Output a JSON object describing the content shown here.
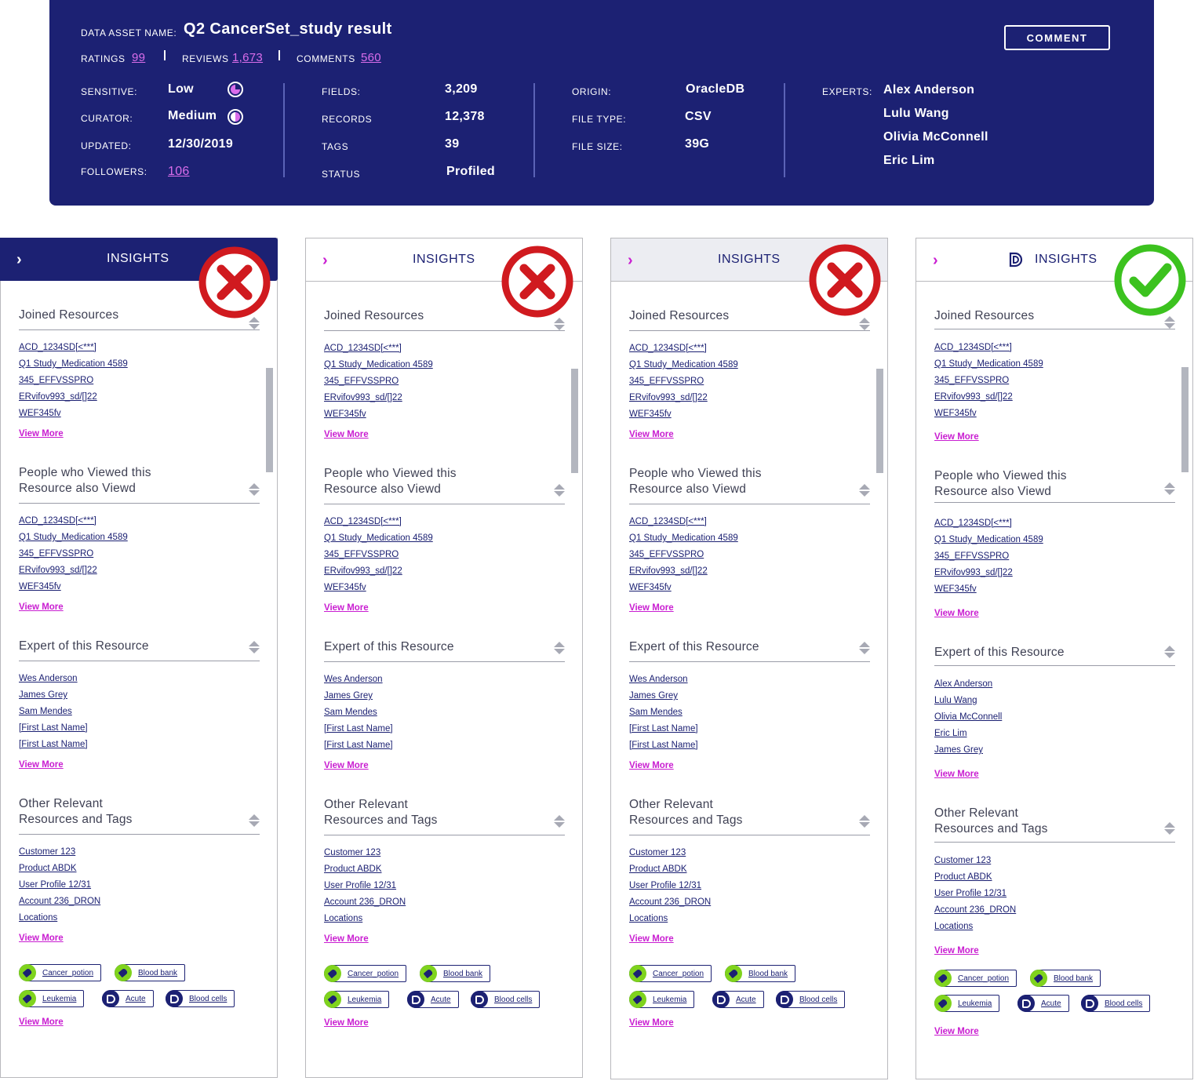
{
  "header": {
    "asset_name_label": "DATA ASSET NAME:",
    "asset_name": "Q2 CancerSet_study result",
    "ratings_label": "RATINGS",
    "ratings": "99",
    "reviews_label": "REVIEWS",
    "reviews": "1,673",
    "comments_label": "COMMENTS",
    "comments": "560",
    "comment_button": "COMMENT",
    "col1": {
      "sensitive_label": "SENSITIVE:",
      "sensitive": "Low",
      "curator_label": "CURATOR:",
      "curator": "Medium",
      "updated_label": "UPDATED:",
      "updated": "12/30/2019",
      "followers_label": "FOLLOWERS:",
      "followers": "106"
    },
    "col2": {
      "fields_label": "FIELDS:",
      "fields": "3,209",
      "records_label": "RECORDS",
      "records": "12,378",
      "tags_label": "TAGS",
      "tags": "39",
      "status_label": "STATUS",
      "status": "Profiled"
    },
    "col3": {
      "origin_label": "ORIGIN:",
      "origin": "OracleDB",
      "filetype_label": "FILE TYPE:",
      "filetype": "CSV",
      "filesize_label": "FILE SIZE:",
      "filesize": "39G"
    },
    "col4": {
      "experts_label": "EXPERTS:",
      "experts": [
        "Alex Anderson",
        "Lulu Wang",
        "Olivia McConnell",
        "Eric Lim"
      ]
    }
  },
  "colors": {
    "navy": "#1c2173",
    "magenta": "#c91ed1",
    "header_link": "#d96dea",
    "tag_green": "#7fd31d",
    "wrong_red": "#d01a1f",
    "right_green": "#3cc21f"
  },
  "panels": [
    {
      "variant": "wrong",
      "header_title": "INSIGHTS",
      "chevron": "›",
      "sections": {
        "joined_title": "Joined Resources",
        "joined_links": [
          "ACD_1234SD[<***]",
          "Q1 Study_Medication 4589",
          "345_EFFVSSPRO",
          "ERvifov993_sd/[]22",
          "WEF345fv"
        ],
        "viewed_title_1": "People who Viewed this",
        "viewed_title_2": "Resource also Viewd",
        "viewed_links": [
          "ACD_1234SD[<***]",
          "Q1 Study_Medication 4589",
          "345_EFFVSSPRO",
          "ERvifov993_sd/[]22",
          "WEF345fv"
        ],
        "expert_title": "Expert of this Resource",
        "expert_links": [
          "Wes Anderson",
          "James Grey",
          "Sam Mendes",
          "[First Last Name]",
          "[First Last Name]"
        ],
        "other_title_1": "Other Relevant",
        "other_title_2": "Resources and Tags",
        "other_links": [
          "Customer 123",
          "Product ABDK",
          "User Profile 12/31",
          "Account 236_DRON",
          "Locations"
        ],
        "tags": [
          "Cancer_potion",
          "Blood bank",
          "Leukemia",
          "Acute",
          "Blood cells"
        ],
        "view_more": "View More"
      }
    },
    {
      "variant": "wrong",
      "header_title": "INSIGHTS",
      "chevron": "›",
      "sections": {
        "joined_title": "Joined Resources",
        "joined_links": [
          "ACD_1234SD[<***]",
          "Q1 Study_Medication 4589",
          "345_EFFVSSPRO",
          "ERvifov993_sd/[]22",
          "WEF345fv"
        ],
        "viewed_title_1": "People who Viewed this",
        "viewed_title_2": "Resource also Viewd",
        "viewed_links": [
          "ACD_1234SD[<***]",
          "Q1 Study_Medication 4589",
          "345_EFFVSSPRO",
          "ERvifov993_sd/[]22",
          "WEF345fv"
        ],
        "expert_title": "Expert of this Resource",
        "expert_links": [
          "Wes Anderson",
          "James Grey",
          "Sam Mendes",
          "[First Last Name]",
          "[First Last Name]"
        ],
        "other_title_1": "Other Relevant",
        "other_title_2": "Resources and Tags",
        "other_links": [
          "Customer 123",
          "Product ABDK",
          "User Profile 12/31",
          "Account 236_DRON",
          "Locations"
        ],
        "tags": [
          "Cancer_potion",
          "Blood bank",
          "Leukemia",
          "Acute",
          "Blood cells"
        ],
        "view_more": "View More"
      }
    },
    {
      "variant": "wrong",
      "header_title": "INSIGHTS",
      "chevron": "›",
      "sections": {
        "joined_title": "Joined Resources",
        "joined_links": [
          "ACD_1234SD[<***]",
          "Q1 Study_Medication 4589",
          "345_EFFVSSPRO",
          "ERvifov993_sd/[]22",
          "WEF345fv"
        ],
        "viewed_title_1": "People who Viewed this",
        "viewed_title_2": "Resource also Viewd",
        "viewed_links": [
          "ACD_1234SD[<***]",
          "Q1 Study_Medication 4589",
          "345_EFFVSSPRO",
          "ERvifov993_sd/[]22",
          "WEF345fv"
        ],
        "expert_title": "Expert of this Resource",
        "expert_links": [
          "Wes Anderson",
          "James Grey",
          "Sam Mendes",
          "[First Last Name]",
          "[First Last Name]"
        ],
        "other_title_1": "Other Relevant",
        "other_title_2": "Resources and Tags",
        "other_links": [
          "Customer 123",
          "Product ABDK",
          "User Profile 12/31",
          "Account 236_DRON",
          "Locations"
        ],
        "tags": [
          "Cancer_potion",
          "Blood bank",
          "Leukemia",
          "Acute",
          "Blood cells"
        ],
        "view_more": "View More"
      }
    },
    {
      "variant": "right",
      "header_title": "INSIGHTS",
      "chevron": "›",
      "sections": {
        "joined_title": "Joined Resources",
        "joined_links": [
          "ACD_1234SD[<***]",
          "Q1 Study_Medication 4589",
          "345_EFFVSSPRO",
          "ERvifov993_sd/[]22",
          "WEF345fv"
        ],
        "viewed_title_1": "People who Viewed this",
        "viewed_title_2": "Resource also Viewd",
        "viewed_links": [
          "ACD_1234SD[<***]",
          "Q1 Study_Medication 4589",
          "345_EFFVSSPRO",
          "ERvifov993_sd/[]22",
          "WEF345fv"
        ],
        "expert_title": "Expert of this Resource",
        "expert_links": [
          "Alex Anderson",
          "Lulu Wang",
          "Olivia McConnell",
          "Eric Lim",
          "James Grey"
        ],
        "other_title_1": "Other Relevant",
        "other_title_2": "Resources and Tags",
        "other_links": [
          "Customer 123",
          "Product ABDK",
          "User Profile 12/31",
          "Account 236_DRON",
          "Locations"
        ],
        "tags": [
          "Cancer_potion",
          "Blood bank",
          "Leukemia",
          "Acute",
          "Blood cells"
        ],
        "view_more": "View More"
      }
    }
  ]
}
